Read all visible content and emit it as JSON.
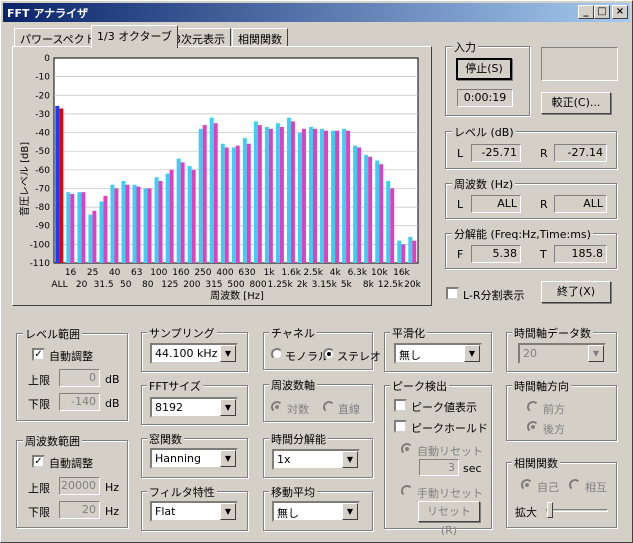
{
  "window": {
    "title": "FFT アナライザ",
    "min_btn": "_",
    "max_btn": "□",
    "close_btn": "×"
  },
  "tabs": [
    "パワースペクトル",
    "1/3 オクターブ",
    "3次元表示",
    "相関関数"
  ],
  "chart_data": {
    "type": "bar",
    "ylabel": "音圧レベル [dB]",
    "xlabel": "周波数 [Hz]",
    "ylim": [
      -110,
      0
    ],
    "yticks": [
      0,
      -10,
      -20,
      -30,
      -40,
      -50,
      -60,
      -70,
      -80,
      -90,
      -100,
      -110
    ],
    "x_labels_top": [
      "16",
      "25",
      "40",
      "63",
      "100",
      "160",
      "250",
      "400",
      "630",
      "1k",
      "1.6k",
      "2.5k",
      "4k",
      "6.3k",
      "10k",
      "16k"
    ],
    "x_labels_bottom": [
      "ALL",
      "20",
      "31.5",
      "50",
      "80",
      "125",
      "200",
      "315",
      "500",
      "800",
      "1.25k",
      "2k",
      "3.15k",
      "5k",
      "8k",
      "12.5k",
      "20k"
    ],
    "categories": [
      "ALL",
      "16",
      "20",
      "25",
      "31.5",
      "40",
      "50",
      "63",
      "80",
      "100",
      "125",
      "160",
      "200",
      "250",
      "315",
      "400",
      "500",
      "630",
      "800",
      "1k",
      "1.25k",
      "1.6k",
      "2k",
      "2.5k",
      "3.15k",
      "4k",
      "5k",
      "6.3k",
      "8k",
      "10k",
      "12.5k",
      "16k",
      "20k"
    ],
    "series": [
      {
        "color": "#3ad0f2",
        "values": [
          -25.7,
          -72,
          -72,
          -84,
          -77,
          -68,
          -66,
          -68,
          -70,
          -64,
          -62,
          -54,
          -58,
          -38,
          -32,
          -46,
          -48,
          -43,
          -34,
          -37,
          -35,
          -32,
          -40,
          -37,
          -38,
          -39,
          -38,
          -47,
          -52,
          -55,
          -66,
          -98,
          -96
        ]
      },
      {
        "color": "#e040c0",
        "values": [
          -27.1,
          -73,
          -72,
          -82,
          -74,
          -70,
          -68,
          -69,
          -70,
          -66,
          -60,
          -56,
          -60,
          -36,
          -35,
          -48,
          -47,
          -46,
          -36,
          -38,
          -37,
          -34,
          -38,
          -38,
          -39,
          -39,
          -39,
          -48,
          -53,
          -57,
          -70,
          -100,
          -98
        ]
      }
    ],
    "all_colors": [
      "#1a3aff",
      "#e00000"
    ],
    "grid": true
  },
  "input_group": {
    "title": "入力",
    "stop_label": "停止(S)",
    "elapsed": "0:00:19",
    "calibrate_label": "較正(C)..."
  },
  "level_group": {
    "title": "レベル (dB)",
    "l_label": "L",
    "l_value": "-25.71",
    "r_label": "R",
    "r_value": "-27.14"
  },
  "freq_group": {
    "title": "周波数 (Hz)",
    "l_label": "L",
    "l_value": "ALL",
    "r_label": "R",
    "r_value": "ALL"
  },
  "res_group": {
    "title": "分解能 (Freq:Hz,Time:ms)",
    "f_label": "F",
    "f_value": "5.38",
    "t_label": "T",
    "t_value": "185.8"
  },
  "lr_split": "L-R分割表示",
  "exit_label": "終了(X)",
  "level_range": {
    "title": "レベル範囲",
    "auto": "自動調整",
    "upper_label": "上限",
    "upper": "0",
    "lower_label": "下限",
    "lower": "-140",
    "unit": "dB"
  },
  "freq_range": {
    "title": "周波数範囲",
    "auto": "自動調整",
    "upper_label": "上限",
    "upper": "20000",
    "lower_label": "下限",
    "lower": "20",
    "unit": "Hz"
  },
  "sampling": {
    "title": "サンプリング",
    "value": "44.100 kHz"
  },
  "fft_size": {
    "title": "FFTサイズ",
    "value": "8192"
  },
  "window_fn": {
    "title": "窓関数",
    "value": "Hanning"
  },
  "filter": {
    "title": "フィルタ特性",
    "value": "Flat"
  },
  "channel": {
    "title": "チャネル",
    "mono": "モノラル",
    "stereo": "ステレオ"
  },
  "freq_axis": {
    "title": "周波数軸",
    "log": "対数",
    "linear": "直線"
  },
  "time_res": {
    "title": "時間分解能",
    "value": "1x"
  },
  "moving_avg": {
    "title": "移動平均",
    "value": "無し"
  },
  "smoothing": {
    "title": "平滑化",
    "value": "無し"
  },
  "peak": {
    "title": "ピーク検出",
    "show": "ピーク値表示",
    "hold": "ピークホールド",
    "auto_reset": "自動リセット",
    "seconds": "3",
    "sec_unit": "sec",
    "manual_reset": "手動リセット",
    "reset_btn": "リセット(R)"
  },
  "time_data": {
    "title": "時間軸データ数",
    "value": "20"
  },
  "time_dir": {
    "title": "時間軸方向",
    "forward": "前方",
    "backward": "後方"
  },
  "corr": {
    "title": "相関関数",
    "auto": "自己",
    "cross": "相互",
    "zoom": "拡大"
  }
}
